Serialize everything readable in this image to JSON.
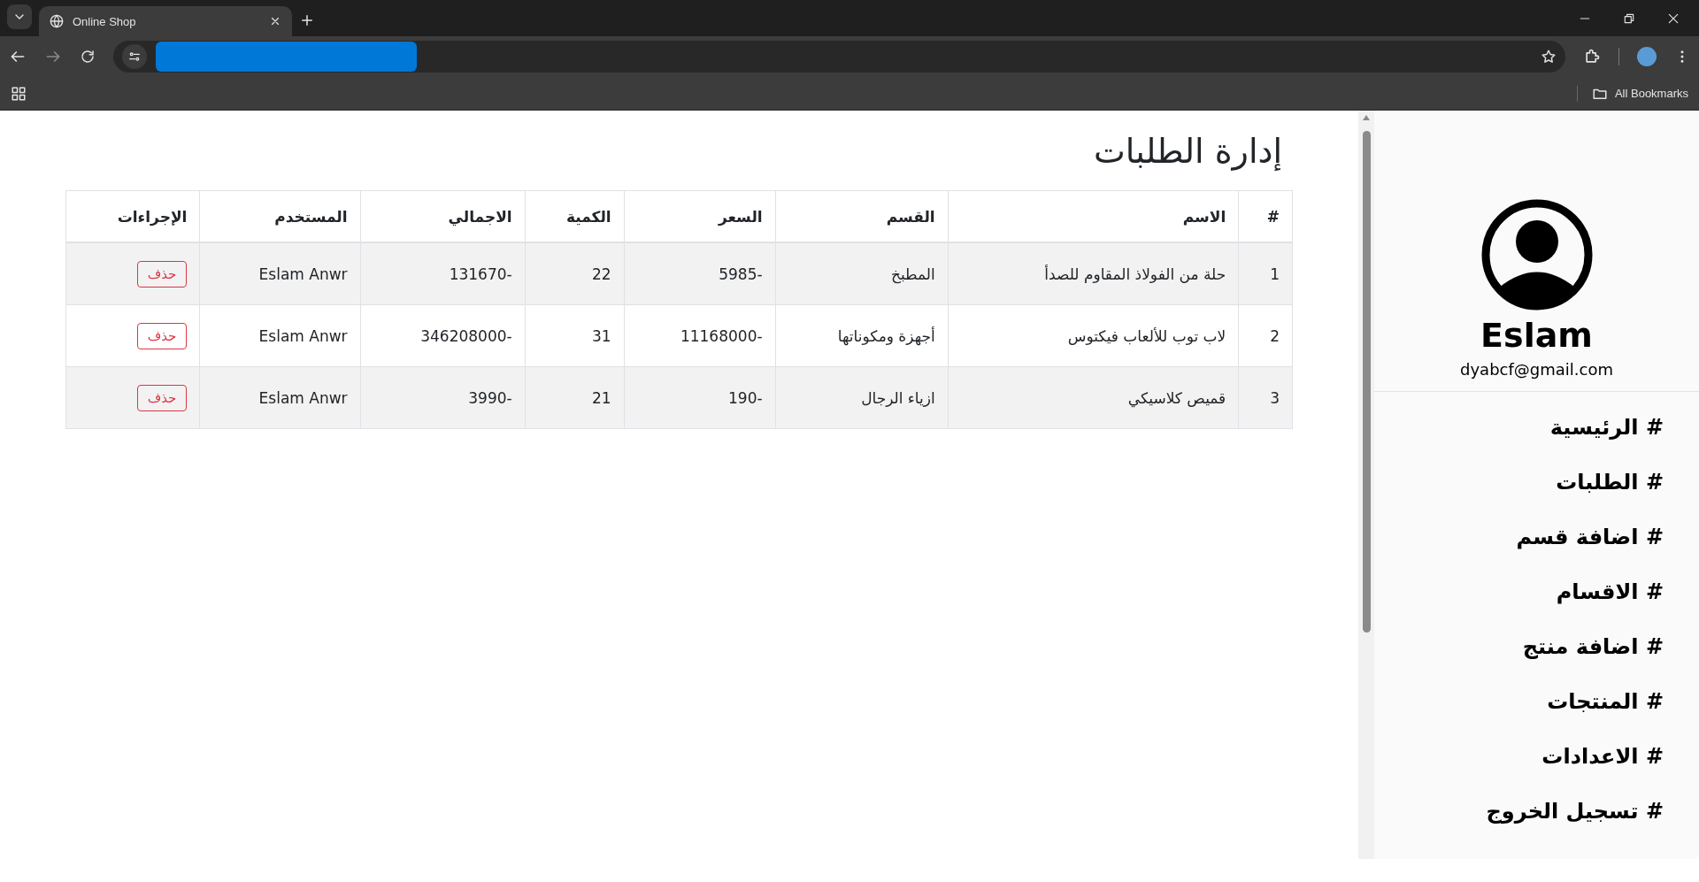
{
  "browser": {
    "tab_title": "Online Shop",
    "bookmarks_label": "All Bookmarks"
  },
  "page": {
    "title": "إدارة الطلبات"
  },
  "table": {
    "columns": [
      "#",
      "الاسم",
      "القسم",
      "السعر",
      "الكمية",
      "الاجمالي",
      "المستخدم",
      "الإجراءات"
    ],
    "rows": [
      {
        "cells": [
          "1",
          "حلة من الفولاذ المقاوم للصدأ",
          "المطبخ",
          "5985-",
          "22",
          "131670-",
          "Eslam Anwr"
        ],
        "action": "حذف"
      },
      {
        "cells": [
          "2",
          "لاب توب للألعاب فيكتوس",
          "أجهزة ومكوناتها",
          "11168000-",
          "31",
          "346208000-",
          "Eslam Anwr"
        ],
        "action": "حذف"
      },
      {
        "cells": [
          "3",
          "قميص كلاسيكي",
          "ازياء الرجال",
          "190-",
          "21",
          "3990-",
          "Eslam Anwr"
        ],
        "action": "حذف"
      }
    ]
  },
  "sidebar": {
    "name": "Eslam",
    "email": "dyabcf@gmail.com",
    "nav": [
      "# الرئيسية",
      "# الطلبات",
      "# اضافة قسم",
      "# الاقسام",
      "# اضافة منتج",
      "# المنتجات",
      "# الاعدادات",
      "# تسجيل الخروج"
    ]
  }
}
